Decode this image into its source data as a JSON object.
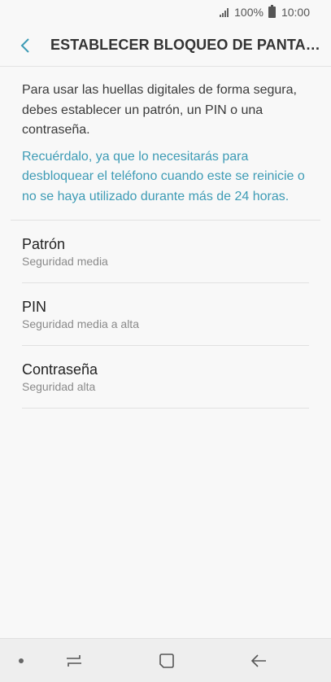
{
  "status_bar": {
    "battery_percent": "100%",
    "time": "10:00"
  },
  "header": {
    "title": "ESTABLECER BLOQUEO DE PANTALLA SEGURO"
  },
  "description": "Para usar las huellas digitales de forma segura, debes establecer un patrón, un PIN o una contraseña.",
  "note": "Recuérdalo, ya que lo necesitarás para desbloquear el teléfono cuando este se reinicie o no se haya utilizado durante más de 24 horas.",
  "options": [
    {
      "label": "Patrón",
      "sub": "Seguridad media"
    },
    {
      "label": "PIN",
      "sub": "Seguridad media a alta"
    },
    {
      "label": "Contraseña",
      "sub": "Seguridad alta"
    }
  ],
  "colors": {
    "accent": "#3d9bb5",
    "background": "#f8f8f8"
  }
}
